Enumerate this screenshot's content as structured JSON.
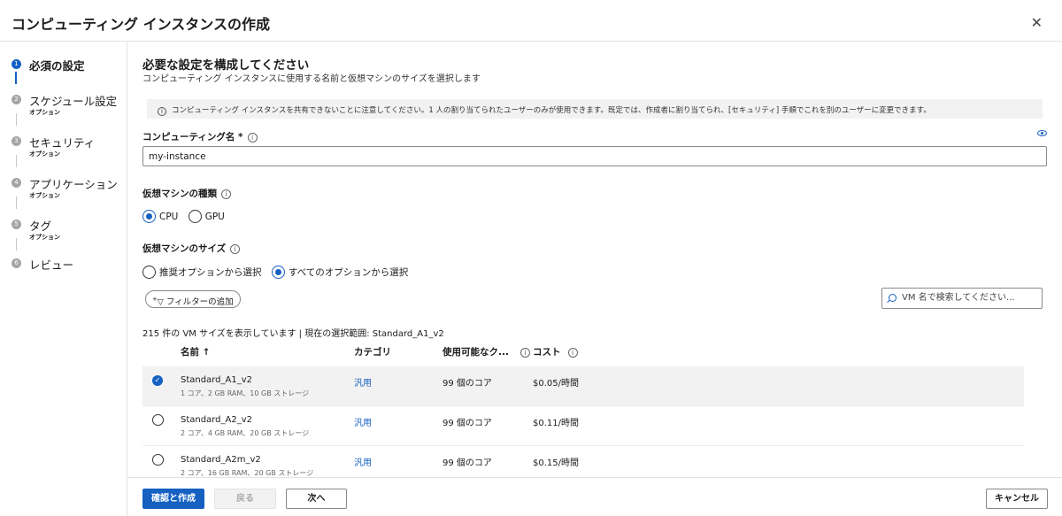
{
  "header": {
    "title": "コンピューティング インスタンスの作成",
    "close_glyph": "✕"
  },
  "sidebar": {
    "steps": [
      {
        "num": "1",
        "label": "必須の設定",
        "sub": ""
      },
      {
        "num": "2",
        "label": "スケジュール設定",
        "sub": "オプション"
      },
      {
        "num": "3",
        "label": "セキュリティ",
        "sub": "オプション"
      },
      {
        "num": "4",
        "label": "アプリケーション",
        "sub": "オプション"
      },
      {
        "num": "5",
        "label": "タグ",
        "sub": "オプション"
      },
      {
        "num": "6",
        "label": "レビュー",
        "sub": ""
      }
    ],
    "active_step": 1
  },
  "main": {
    "heading": "必要な設定を構成してください",
    "subheading": "コンピューティング インスタンスに使用する名前と仮想マシンのサイズを選択します",
    "info_bar": "コンピューティング インスタンスを共有できないことに注意してください。1 人の割り当てられたユーザーのみが使用できます。既定では、作成者に割り当てられ、[セキュリティ] 手順でこれを別のユーザーに変更できます。",
    "compute_name": {
      "label": "コンピューティング名 *",
      "value": "my-instance"
    },
    "vm_type": {
      "label": "仮想マシンの種類",
      "options": [
        "CPU",
        "GPU"
      ],
      "selected": "CPU"
    },
    "vm_size": {
      "label": "仮想マシンのサイズ",
      "options": [
        "推奨オプションから選択",
        "すべてのオプションから選択"
      ],
      "selected": "すべてのオプションから選択"
    },
    "filter_button": "フィルターの追加",
    "search_placeholder": "VM 名で検索してください...",
    "count_text": "215 件の VM サイズを表示しています | 現在の選択範囲: Standard_A1_v2",
    "columns": {
      "name": "名前 ↑",
      "category": "カテゴリ",
      "available": "使用可能なク...",
      "cost": "コスト"
    },
    "rows": [
      {
        "name": "Standard_A1_v2",
        "spec": "1 コア、2 GB RAM、10 GB ストレージ",
        "category": "汎用",
        "cores": "99 個のコア",
        "cost": "$0.05/時間",
        "selected": true
      },
      {
        "name": "Standard_A2_v2",
        "spec": "2 コア、4 GB RAM、20 GB ストレージ",
        "category": "汎用",
        "cores": "99 個のコア",
        "cost": "$0.11/時間",
        "selected": false
      },
      {
        "name": "Standard_A2m_v2",
        "spec": "2 コア、16 GB RAM、20 GB ストレージ",
        "category": "汎用",
        "cores": "99 個のコア",
        "cost": "$0.15/時間",
        "selected": false
      }
    ]
  },
  "footer": {
    "review_create": "確認と作成",
    "back": "戻る",
    "next": "次へ",
    "cancel": "キャンセル"
  },
  "colors": {
    "accent": "#1560c1",
    "disabled_bg": "#f2f2f2",
    "selected_row_bg": "#f2f2f2"
  }
}
